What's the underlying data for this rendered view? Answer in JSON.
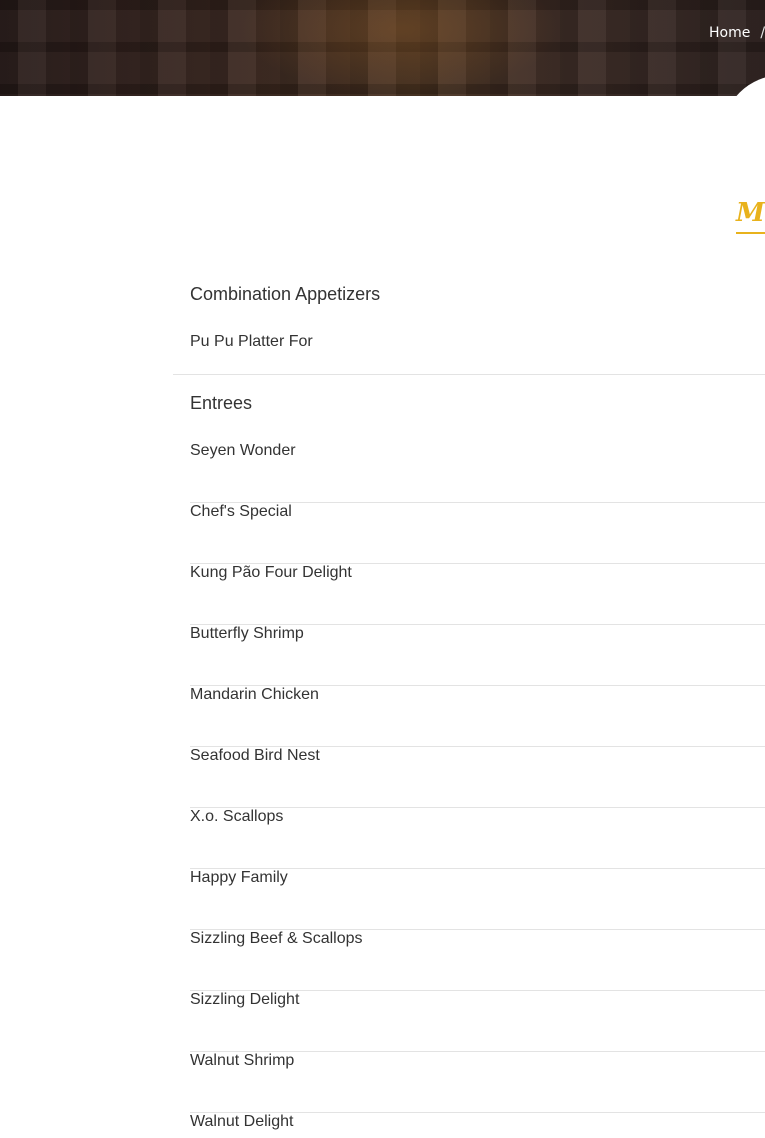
{
  "breadcrumb": {
    "home": "Home",
    "separator": "/"
  },
  "menu_title": "Me",
  "colors": {
    "accent": "#e8b21c",
    "text": "#333333",
    "divider": "#e3e3e3"
  },
  "sections": [
    {
      "heading": "Combination Appetizers",
      "items": [
        "Pu Pu Platter For"
      ]
    },
    {
      "heading": "Entrees",
      "items": [
        "Seyen Wonder",
        "Chef's Special",
        "Kung Pão Four Delight",
        "Butterfly Shrimp",
        "Mandarin Chicken",
        "Seafood Bird Nest",
        "X.o. Scallops",
        "Happy Family",
        "Sizzling Beef & Scallops",
        "Sizzling Delight",
        "Walnut Shrimp",
        "Walnut Delight"
      ]
    }
  ]
}
